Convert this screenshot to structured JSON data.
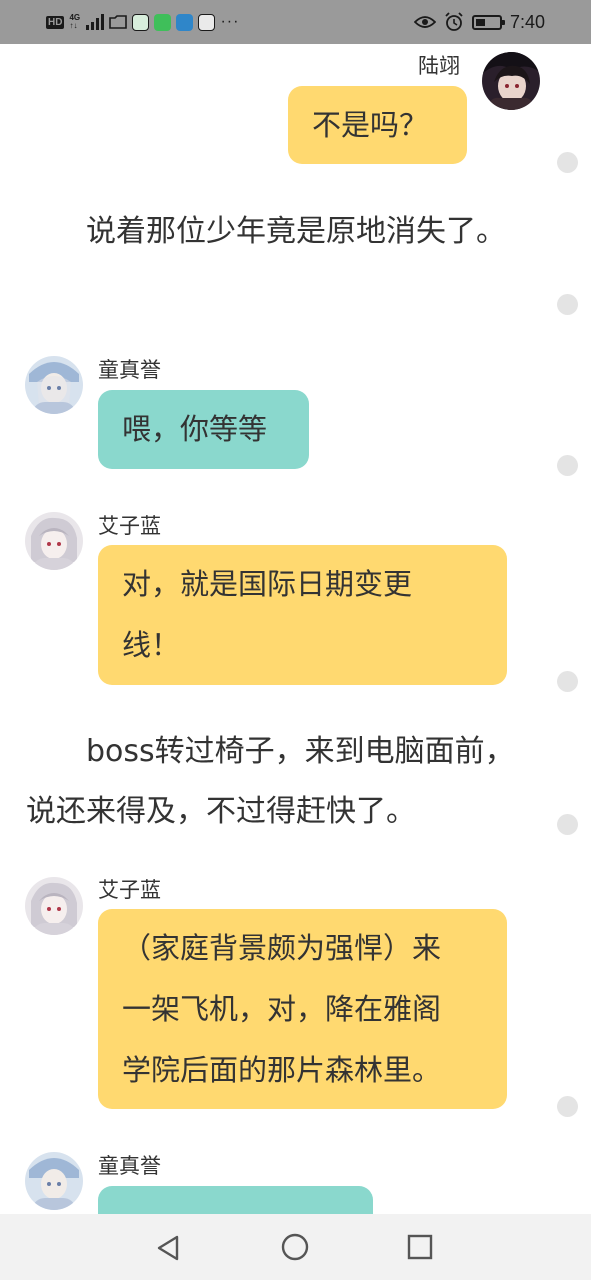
{
  "status_bar": {
    "left_icons": [
      "hd-icon",
      "network-4g-icon",
      "signal-icon",
      "folder-icon",
      "app-icon",
      "app-icon",
      "app-icon",
      "app-icon",
      "more-icon"
    ],
    "time": "7:40",
    "battery_level": 0.4
  },
  "chat": [
    {
      "type": "message",
      "side": "right",
      "name": "陆翊",
      "text": "不是吗？",
      "bubble_color": "#ffd970"
    },
    {
      "type": "narration",
      "text": "说着那位少年竟是原地消失了。"
    },
    {
      "type": "message",
      "side": "left",
      "name": "童真誉",
      "text": "喂，你等等",
      "bubble_color": "#8ad8cd"
    },
    {
      "type": "message",
      "side": "left",
      "name": "艾子蓝",
      "lines": [
        "对，就是国际日期变更",
        "线！"
      ],
      "bubble_color": "#ffd970"
    },
    {
      "type": "narration",
      "text": "boss转过椅子，来到电脑面前，说还来得及，不过得赶快了。"
    },
    {
      "type": "message",
      "side": "left",
      "name": "艾子蓝",
      "lines": [
        "（家庭背景颇为强悍）来",
        "一架飞机，对，降在雅阁",
        "学院后面的那片森林里。"
      ],
      "bubble_color": "#ffd970"
    },
    {
      "type": "message",
      "side": "left",
      "name": "童真誉",
      "text": "",
      "bubble_color": "#8ad8cd"
    }
  ],
  "nav_bar": {
    "icons": [
      "back-icon",
      "home-icon",
      "recents-icon"
    ]
  }
}
